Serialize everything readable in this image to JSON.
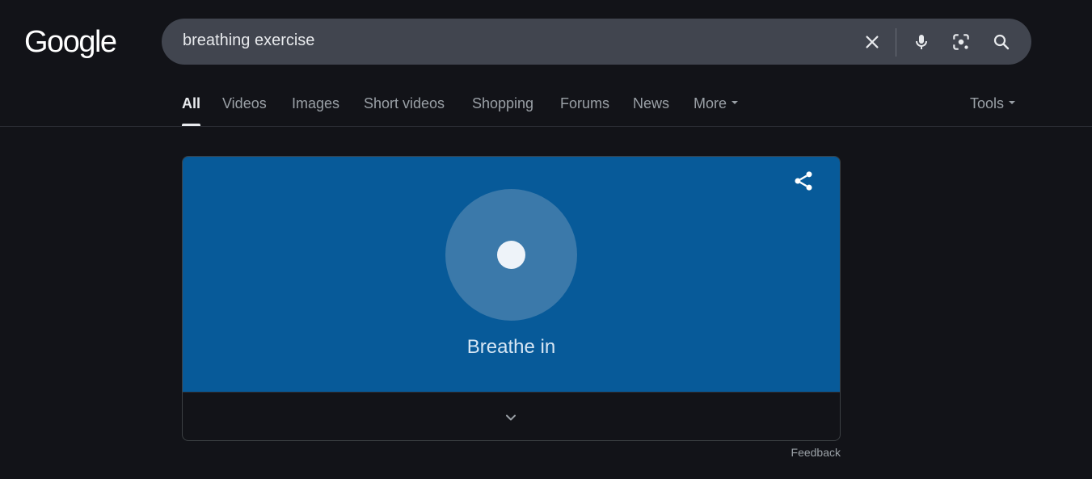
{
  "logo": {
    "text": "Google"
  },
  "search": {
    "query": "breathing exercise",
    "icons": [
      "clear-icon",
      "microphone-icon",
      "lens-icon",
      "search-icon"
    ]
  },
  "tabs": [
    {
      "label": "All",
      "active": true
    },
    {
      "label": "Videos"
    },
    {
      "label": "Images"
    },
    {
      "label": "Short videos"
    },
    {
      "label": "Shopping"
    },
    {
      "label": "Forums"
    },
    {
      "label": "News"
    },
    {
      "label": "More"
    }
  ],
  "tools": {
    "label": "Tools"
  },
  "breathing_card": {
    "status_text": "Breathe in",
    "accent_color": "#075a99",
    "icons": [
      "share-icon",
      "chevron-down-icon"
    ]
  },
  "feedback": {
    "label": "Feedback"
  }
}
